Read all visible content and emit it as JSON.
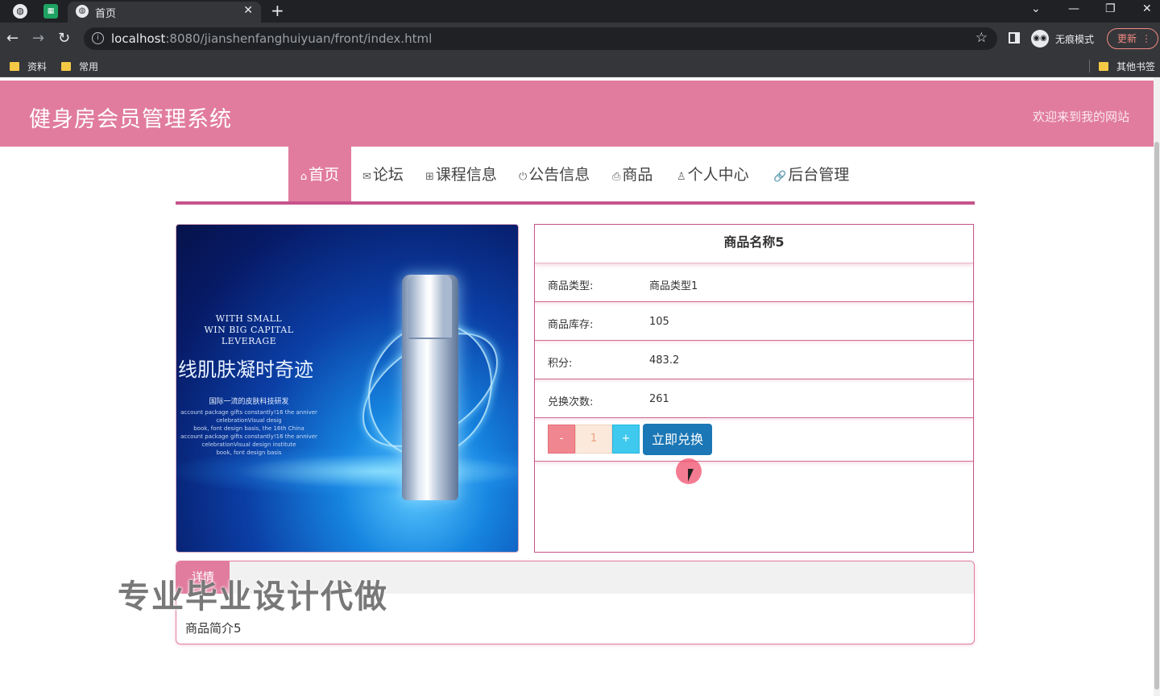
{
  "browser": {
    "tab_title": "首页",
    "url_host": "localhost",
    "url_rest": ":8080/jianshenfanghuiyuan/front/index.html",
    "incognito_label": "无痕模式",
    "update_label": "更新",
    "bookmarks": [
      "资料",
      "常用"
    ],
    "other_bookmarks": "其他书签",
    "glyphs": {
      "new_tab": "+",
      "close": "✕",
      "back": "←",
      "forward": "→",
      "reload": "↻",
      "star": "☆",
      "minimize": "—",
      "restore": "❐",
      "chevron": "⌄",
      "menu_dots": "⋮",
      "info": "i"
    }
  },
  "site": {
    "title": "健身房会员管理系统",
    "welcome": "欢迎来到我的网站"
  },
  "nav": [
    {
      "label": "首页",
      "icon": "⌂",
      "icon_name": "home-icon",
      "active": true
    },
    {
      "label": "论坛",
      "icon": "✉",
      "icon_name": "mail-icon",
      "active": false
    },
    {
      "label": "课程信息",
      "icon": "⊞",
      "icon_name": "grid-icon",
      "active": false
    },
    {
      "label": "公告信息",
      "icon": "⏻",
      "icon_name": "power-icon",
      "active": false
    },
    {
      "label": "商品",
      "icon": "⎙",
      "icon_name": "printer-icon",
      "active": false
    },
    {
      "label": "个人中心",
      "icon": "♙",
      "icon_name": "user-icon",
      "active": false
    },
    {
      "label": "后台管理",
      "icon": "🔗",
      "icon_name": "link-icon",
      "active": false
    }
  ],
  "product": {
    "name": "商品名称5",
    "rows": [
      {
        "label": "商品类型:",
        "value": "商品类型1"
      },
      {
        "label": "商品库存:",
        "value": "105"
      },
      {
        "label": "积分:",
        "value": "483.2"
      },
      {
        "label": "兑换次数:",
        "value": "261"
      }
    ],
    "qty_minus": "-",
    "qty_value": "1",
    "qty_plus": "+",
    "redeem_label": "立即兑换",
    "image": {
      "line1": "WITH SMALL",
      "line2": "WIN BIG CAPITAL LEVERAGE",
      "headline": "线肌肤凝时奇迹",
      "small_title": "国际一流的皮肤科技研发",
      "small_lines": [
        "account package gifts constantly!16 the anniver",
        "celebrationVisual desig",
        "book, font design basis, the 16th China",
        "account package gifts constantly!16 the anniver",
        "celebrationVisual design institute",
        "book, font design basis"
      ]
    }
  },
  "details": {
    "tab_label": "详情",
    "text": "商品简介5"
  },
  "watermark": "专业毕业设计代做",
  "colors": {
    "brand_pink": "#e17c9f",
    "nav_underline": "#c7538a",
    "redeem_blue": "#1b77b5",
    "plus_cyan": "#3fc9ee",
    "minus_red": "#f0868f"
  }
}
